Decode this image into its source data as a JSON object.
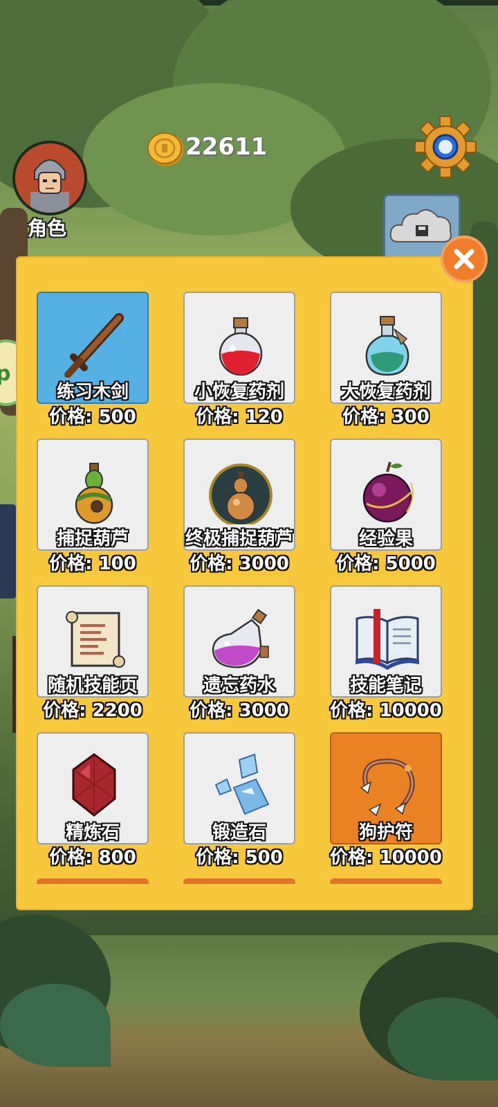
{
  "hud": {
    "role_label": "角色",
    "coins": "22611"
  },
  "shop": {
    "items": [
      {
        "name": "练习木剑",
        "price": "价格: 500",
        "icon": "wooden-sword-icon"
      },
      {
        "name": "小恢复药剂",
        "price": "价格: 120",
        "icon": "small-potion-icon"
      },
      {
        "name": "大恢复药剂",
        "price": "价格: 300",
        "icon": "large-potion-icon"
      },
      {
        "name": "捕捉葫芦",
        "price": "价格: 100",
        "icon": "capture-gourd-icon"
      },
      {
        "name": "终极捕捉葫芦",
        "price": "价格: 3000",
        "icon": "ultimate-gourd-icon"
      },
      {
        "name": "经验果",
        "price": "价格: 5000",
        "icon": "exp-fruit-icon"
      },
      {
        "name": "随机技能页",
        "price": "价格: 2200",
        "icon": "scroll-icon"
      },
      {
        "name": "遗忘药水",
        "price": "价格: 3000",
        "icon": "forget-potion-icon"
      },
      {
        "name": "技能笔记",
        "price": "价格: 10000",
        "icon": "book-icon"
      },
      {
        "name": "精炼石",
        "price": "价格: 800",
        "icon": "ruby-icon"
      },
      {
        "name": "锻造石",
        "price": "价格: 500",
        "icon": "crystal-icon"
      },
      {
        "name": "狗护符",
        "price": "价格: 10000",
        "icon": "amulet-icon"
      }
    ]
  },
  "colors": {
    "panel": "#f7c83c",
    "selected_card": "#56b0e3",
    "highlight_card": "#ea8224",
    "close_button": "#ef7d2a"
  },
  "side": {
    "left_pill_text": "p"
  }
}
